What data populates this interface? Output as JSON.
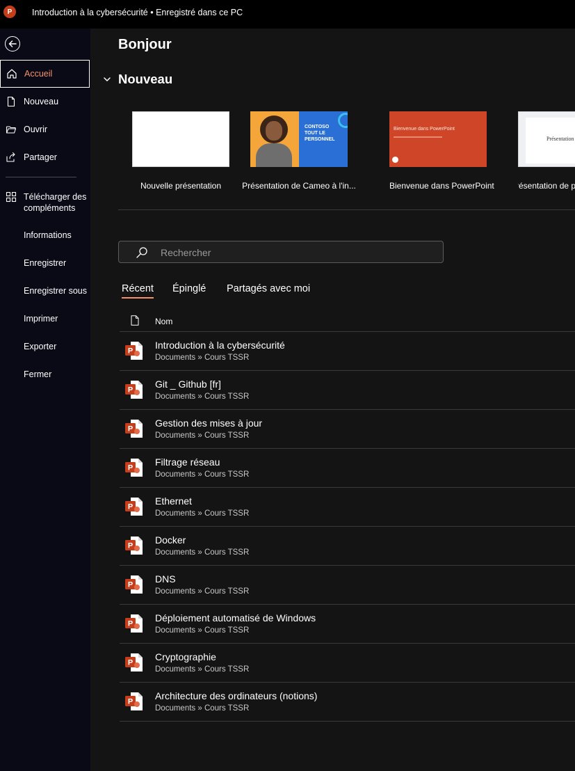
{
  "titlebar": {
    "app_icon_letter": "P",
    "title": "Introduction à la cybersécurité • Enregistré dans ce PC"
  },
  "sidebar": {
    "items": [
      {
        "label": "Accueil",
        "icon": "home-icon",
        "active": true
      },
      {
        "label": "Nouveau",
        "icon": "new-file-icon"
      },
      {
        "label": "Ouvrir",
        "icon": "open-folder-icon"
      },
      {
        "label": "Partager",
        "icon": "share-icon"
      },
      {
        "label": "Télécharger des compléments",
        "icon": "add-ins-icon"
      },
      {
        "label": "Informations"
      },
      {
        "label": "Enregistrer"
      },
      {
        "label": "Enregistrer sous"
      },
      {
        "label": "Imprimer"
      },
      {
        "label": "Exporter"
      },
      {
        "label": "Fermer"
      }
    ]
  },
  "main": {
    "greeting": "Bonjour",
    "new_section_title": "Nouveau",
    "templates": [
      {
        "label": "Nouvelle présentation"
      },
      {
        "label": "Présentation de Cameo à l'in...",
        "thumb_text": [
          "CONTOSO",
          "TOUT LE",
          "PERSONNEL"
        ]
      },
      {
        "label": "Bienvenue dans PowerPoint",
        "thumb_text": "Bienvenue dans PowerPoint"
      },
      {
        "label": "Présentation de pl",
        "thumb_text": "Présentation d"
      }
    ],
    "search_placeholder": "Rechercher",
    "tabs": [
      "Récent",
      "Épinglé",
      "Partagés avec moi"
    ],
    "list_header": "Nom",
    "files": [
      {
        "name": "Introduction à la cybersécurité",
        "path": "Documents » Cours TSSR"
      },
      {
        "name": "Git _ Github [fr]",
        "path": "Documents » Cours TSSR"
      },
      {
        "name": "Gestion des mises à jour",
        "path": "Documents » Cours TSSR"
      },
      {
        "name": "Filtrage réseau",
        "path": "Documents » Cours TSSR"
      },
      {
        "name": "Ethernet",
        "path": "Documents » Cours TSSR"
      },
      {
        "name": "Docker",
        "path": "Documents » Cours TSSR"
      },
      {
        "name": "DNS",
        "path": "Documents » Cours TSSR"
      },
      {
        "name": "Déploiement automatisé de Windows",
        "path": "Documents » Cours TSSR"
      },
      {
        "name": "Cryptographie",
        "path": "Documents » Cours TSSR"
      },
      {
        "name": "Architecture des ordinateurs (notions)",
        "path": "Documents » Cours TSSR"
      }
    ]
  },
  "colors": {
    "accent": "#f4916b",
    "ppt_red": "#c43e1c",
    "sidebar_bg": "#0a0a16",
    "main_bg": "#141414"
  }
}
